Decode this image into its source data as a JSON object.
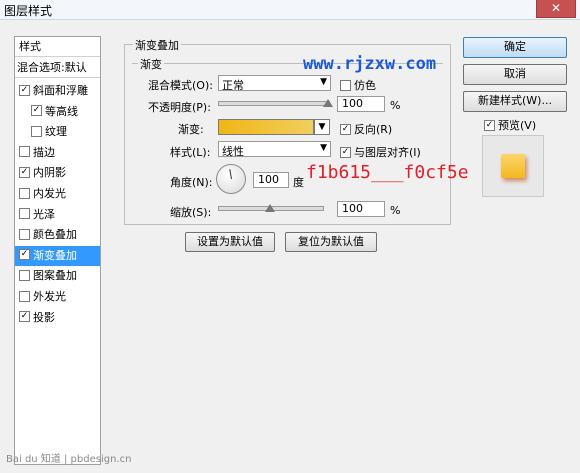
{
  "window": {
    "title": "图层样式",
    "close_glyph": "✕"
  },
  "sidebar": {
    "header": "样式",
    "blend_options": "混合选项:默认",
    "items": [
      {
        "label": "斜面和浮雕",
        "checked": true,
        "indent": false
      },
      {
        "label": "等高线",
        "checked": true,
        "indent": true
      },
      {
        "label": "纹理",
        "checked": false,
        "indent": true
      },
      {
        "label": "描边",
        "checked": false,
        "indent": false
      },
      {
        "label": "内阴影",
        "checked": true,
        "indent": false
      },
      {
        "label": "内发光",
        "checked": false,
        "indent": false
      },
      {
        "label": "光泽",
        "checked": false,
        "indent": false
      },
      {
        "label": "颜色叠加",
        "checked": false,
        "indent": false
      },
      {
        "label": "渐变叠加",
        "checked": true,
        "indent": false,
        "selected": true
      },
      {
        "label": "图案叠加",
        "checked": false,
        "indent": false
      },
      {
        "label": "外发光",
        "checked": false,
        "indent": false
      },
      {
        "label": "投影",
        "checked": true,
        "indent": false
      }
    ]
  },
  "panel": {
    "group_title": "渐变叠加",
    "subgroup_title": "渐变",
    "blend_mode_label": "混合模式(O):",
    "blend_mode_value": "正常",
    "dither_label": "仿色",
    "dither_checked": false,
    "opacity_label": "不透明度(P):",
    "opacity_value": "100",
    "opacity_level": 1.0,
    "percent": "%",
    "gradient_label": "渐变:",
    "gradient_colors": [
      "#f1b615",
      "#f0cf5e"
    ],
    "reverse_label": "反向(R)",
    "reverse_checked": true,
    "style_label": "样式(L):",
    "style_value": "线性",
    "align_label": "与图层对齐(I)",
    "align_checked": true,
    "angle_label": "角度(N):",
    "angle_value": "100",
    "angle_unit": "度",
    "scale_label": "缩放(S):",
    "scale_value": "100",
    "scale_level": 0.5,
    "make_default": "设置为默认值",
    "reset_default": "复位为默认值"
  },
  "right": {
    "ok": "确定",
    "cancel": "取消",
    "new_style": "新建样式(W)...",
    "preview_label": "预览(V)",
    "preview_checked": true
  },
  "overlays": {
    "watermark": "www.rjzxw.com",
    "annotation": "f1b615___f0cf5e",
    "baidu": "Bai du 知道 | pbdesign.cn"
  },
  "colors": {
    "selection": "#3399ff",
    "annotation_red": "#e0202a",
    "watermark_blue": "#1e5ad8"
  }
}
